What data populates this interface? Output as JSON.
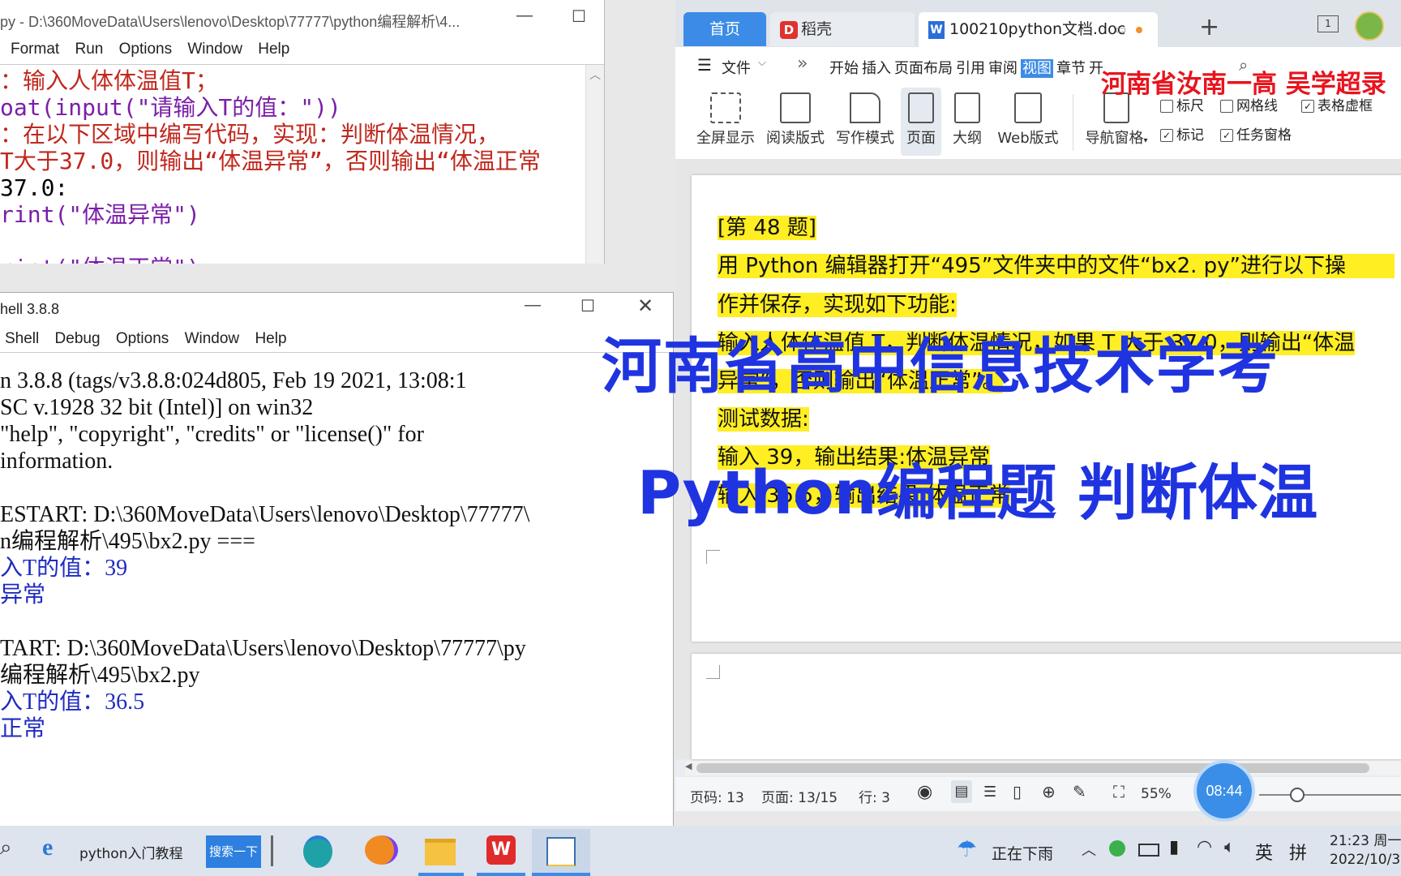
{
  "editor": {
    "title": "py - D:\\360MoveData\\Users\\lenovo\\Desktop\\77777\\python编程解析\\4...",
    "menu": [
      "Format",
      "Run",
      "Options",
      "Window",
      "Help"
    ],
    "lines": [
      {
        "t": "：输入人体体温值T；",
        "c": "red"
      },
      {
        "t": "oat(input(\"请输入T的值：\"))",
        "c": "mix1"
      },
      {
        "t": "：在以下区域中编写代码，实现：判断体温情况，",
        "c": "red"
      },
      {
        "t": "T大于37.0，则输出“体温异常”，否则输出“体温正常",
        "c": "red"
      },
      {
        "t": "37.0:",
        "c": "black"
      },
      {
        "t": "rint(\"体温异常\")",
        "c": "mix2"
      },
      {
        "t": "",
        "c": "black"
      },
      {
        "t": "rint(\"体温正常\")",
        "c": "mix2"
      }
    ]
  },
  "shell": {
    "title": "hell 3.8.8",
    "menu": [
      "Shell",
      "Debug",
      "Options",
      "Window",
      "Help"
    ],
    "lines": [
      {
        "t": "n 3.8.8 (tags/v3.8.8:024d805, Feb 19 2021, 13:08:1",
        "c": "black"
      },
      {
        "t": "SC v.1928 32 bit (Intel)] on win32",
        "c": "black"
      },
      {
        "t": "\"help\", \"copyright\", \"credits\" or \"license()\" for",
        "c": "black"
      },
      {
        "t": "information.",
        "c": "black"
      },
      {
        "t": "",
        "c": "black"
      },
      {
        "t": "ESTART: D:\\360MoveData\\Users\\lenovo\\Desktop\\77777\\",
        "c": "black"
      },
      {
        "t": "n编程解析\\495\\bx2.py ===",
        "c": "black"
      },
      {
        "t": "入T的值：39",
        "c": "blue"
      },
      {
        "t": "异常",
        "c": "blue"
      },
      {
        "t": "",
        "c": "black"
      },
      {
        "t": "TART: D:\\360MoveData\\Users\\lenovo\\Desktop\\77777\\py",
        "c": "black"
      },
      {
        "t": "编程解析\\495\\bx2.py",
        "c": "black"
      },
      {
        "t": "入T的值：36.5",
        "c": "blue"
      },
      {
        "t": "正常",
        "c": "blue"
      }
    ]
  },
  "wps": {
    "tabs": {
      "home": "首页",
      "daoke": "稻壳",
      "doc": "100210python文档.doc",
      "add": "+"
    },
    "badge": "1",
    "menu": {
      "file": "文件",
      "more": "»",
      "items": [
        "开始",
        "插入",
        "页面布局",
        "引用",
        "审阅",
        "视图",
        "章节",
        "开"
      ],
      "active": "视图"
    },
    "ribbon": [
      "全屏显示",
      "阅读版式",
      "写作模式",
      "页面",
      "大纲",
      "Web版式",
      "导航窗格"
    ],
    "checks": [
      {
        "label": "标尺",
        "checked": false
      },
      {
        "label": "网格线",
        "checked": false
      },
      {
        "label": "表格虚框",
        "checked": true
      },
      {
        "label": "标记",
        "checked": true
      },
      {
        "label": "任务窗格",
        "checked": true
      }
    ],
    "doc": {
      "heading": "[第 48 题]",
      "p1": "用 Python 编辑器打开“495”文件夹中的文件“bx2. py”进行以下操",
      "p2": "作并保存，实现如下功能:",
      "p3": "输入人体体温值 T，判断体温情况，如果 T 大于 37.0，则输出“体温",
      "p4": "异常”，否则输出“体温正常”。",
      "p5": "测试数据:",
      "p6": "输入 39，输出结果:体温异常",
      "p7": "输入 36.5，输出结果:体温正常"
    },
    "status": {
      "pageno": "页码: 13",
      "page": "页面: 13/15",
      "row": "行: 3",
      "zoom": "55%"
    }
  },
  "overlay": {
    "red_caption": "河南省汝南一高 吴学超录",
    "title1": "河南省高中信息技术学考",
    "title2": "Python编程题 判断体温",
    "timer": "08:44"
  },
  "taskbar": {
    "browser_label": "python入门教程",
    "search_btn": "搜索一下",
    "weather": "正在下雨",
    "ime1": "英",
    "ime2": "拼",
    "time": "21:23 周一",
    "date": "2022/10/3"
  },
  "colors": {
    "accent": "#3c8ce7",
    "highlight": "#ffee22",
    "overlay_blue": "#1f34e0",
    "caption_red": "#e8141e"
  }
}
